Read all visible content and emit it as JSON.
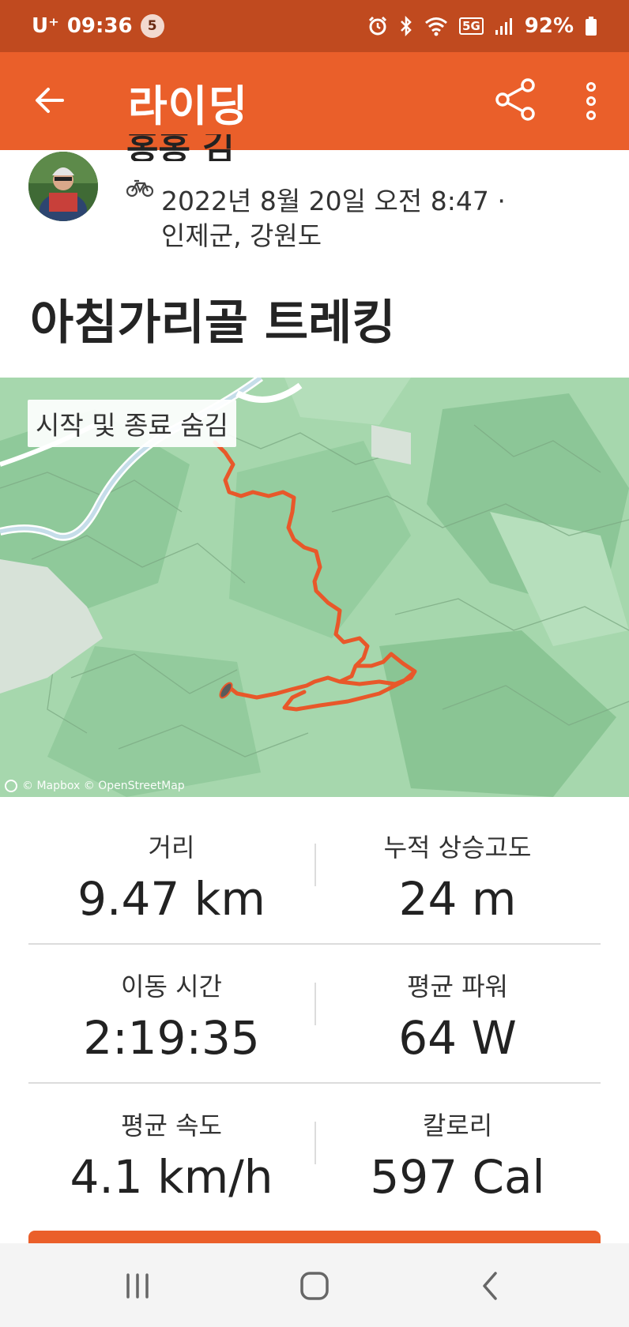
{
  "status_bar": {
    "carrier": "U⁺",
    "time": "09:36",
    "notification_count": "5",
    "battery": "92%",
    "network": "5G"
  },
  "app_bar": {
    "title": "라이딩",
    "back_icon": "arrow-left-icon",
    "share_icon": "share-icon",
    "more_icon": "more-vertical-icon"
  },
  "activity": {
    "user_name_partial": "홍홍 김",
    "datetime": "2022년 8월 20일 오전 8:47 ·",
    "location": "인제군, 강원도",
    "title": "아침가리골 트레킹",
    "type_icon": "bicycle-icon"
  },
  "map": {
    "hide_button": "시작 및 종료 숨김",
    "attribution": "© Mapbox © OpenStreetMap",
    "route_color": "#e8582a"
  },
  "stats": [
    {
      "label": "거리",
      "value": "9.47 km"
    },
    {
      "label": "누적 상승고도",
      "value": "24 m"
    },
    {
      "label": "이동 시간",
      "value": "2:19:35"
    },
    {
      "label": "평균 파워",
      "value": "64 W"
    },
    {
      "label": "평균 속도",
      "value": "4.1 km/h"
    },
    {
      "label": "칼로리",
      "value": "597 Cal"
    }
  ],
  "colors": {
    "status_bar": "#c04a1f",
    "app_bar": "#ea5f2a",
    "accent": "#ea5f2a"
  }
}
